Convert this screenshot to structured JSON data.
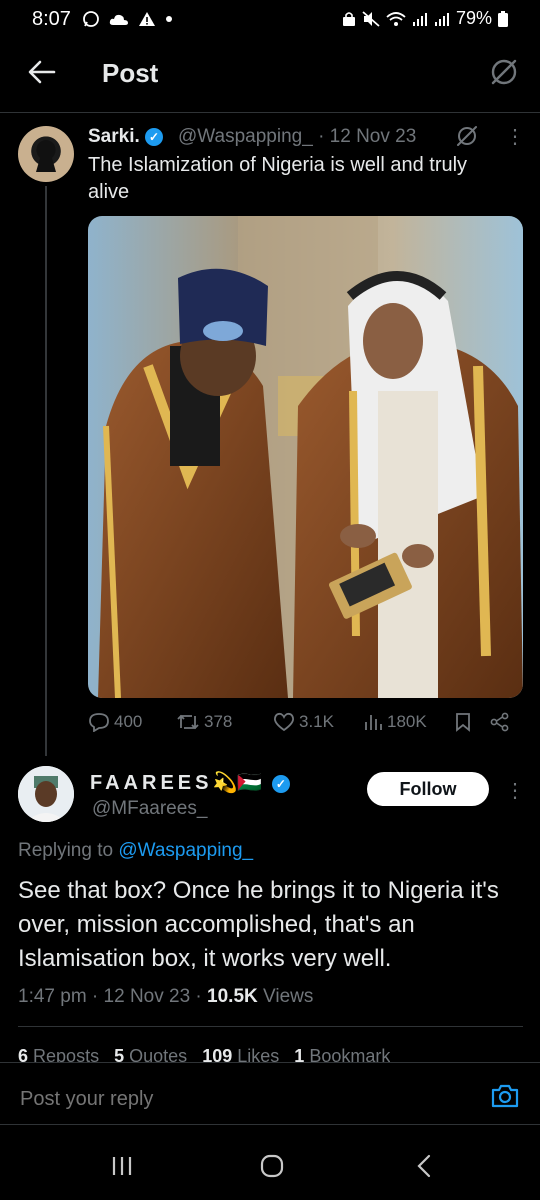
{
  "status_bar": {
    "time": "8:07",
    "battery": "79%",
    "left_icons": [
      "whatsapp-icon",
      "cloud-icon",
      "warning-icon",
      "dot-icon"
    ],
    "right_icons": [
      "lock-icon",
      "mute-icon",
      "wifi-icon",
      "signal-icon",
      "signal-icon",
      "battery-icon"
    ]
  },
  "header": {
    "title": "Post"
  },
  "original_post": {
    "name": "Sarki.",
    "handle": "@Waspapping_",
    "date": "· 12 Nov 23",
    "text": "The Islamization of Nigeria is well and truly alive",
    "actions": {
      "replies": "400",
      "reposts": "378",
      "likes": "3.1K",
      "views": "180K"
    }
  },
  "reply": {
    "name": "FAAREES",
    "name_emojis": "💫🇵🇸",
    "handle": "@MFaarees_",
    "follow_label": "Follow",
    "replying_prefix": "Replying to",
    "replying_to": "@Waspapping_",
    "text": "See that box? Once he brings it to Nigeria it's over, mission accomplished, that's an Islamisation box, it works very well.",
    "time": "1:47 pm · 12 Nov 23 ·",
    "views_count": "10.5K",
    "views_label": "Views",
    "stats": [
      {
        "count": "6",
        "label": "Reposts"
      },
      {
        "count": "5",
        "label": "Quotes"
      },
      {
        "count": "109",
        "label": "Likes"
      },
      {
        "count": "1",
        "label": "Bookmark"
      }
    ]
  },
  "reply_bar": {
    "placeholder": "Post your reply"
  },
  "colors": {
    "accent": "#1d9bf0",
    "background": "#000000",
    "muted": "#71767b"
  }
}
